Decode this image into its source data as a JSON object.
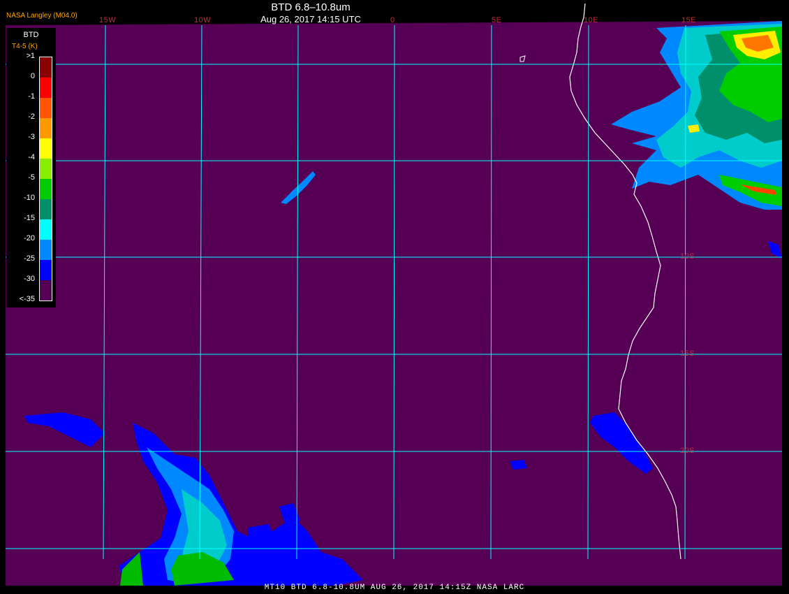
{
  "header": {
    "title": "BTD 6.8–10.8um",
    "datetime": "Aug 26, 2017 14:15 UTC",
    "credit": "NASA Langley (M04.0)"
  },
  "legend": {
    "title": "BTD",
    "units": "T4-5 (K)",
    "labels": [
      ">1",
      "0",
      "-1",
      "-2",
      "-3",
      "-4",
      "-5",
      "-10",
      "-15",
      "-20",
      "-25",
      "-30",
      "<-35"
    ],
    "colors": [
      "#8b0000",
      "#ff0000",
      "#ff5500",
      "#ff9900",
      "#ffff00",
      "#88ee00",
      "#00cc00",
      "#008f6b",
      "#00ffff",
      "#0088ff",
      "#0000ff",
      "#550055"
    ]
  },
  "lon_labels": [
    "15W",
    "10W",
    "0",
    "5E",
    "10E",
    "15E"
  ],
  "lat_labels": [
    "10S",
    "15S",
    "20S"
  ],
  "footer": "MT10   BTD 6.8-10.8UM   AUG 26, 2017 14:15Z   NASA LARC",
  "colors": {
    "background": "#550055",
    "grid": "#00ffff",
    "coastline": "#ffffff",
    "grid_label": "#c0303a"
  }
}
